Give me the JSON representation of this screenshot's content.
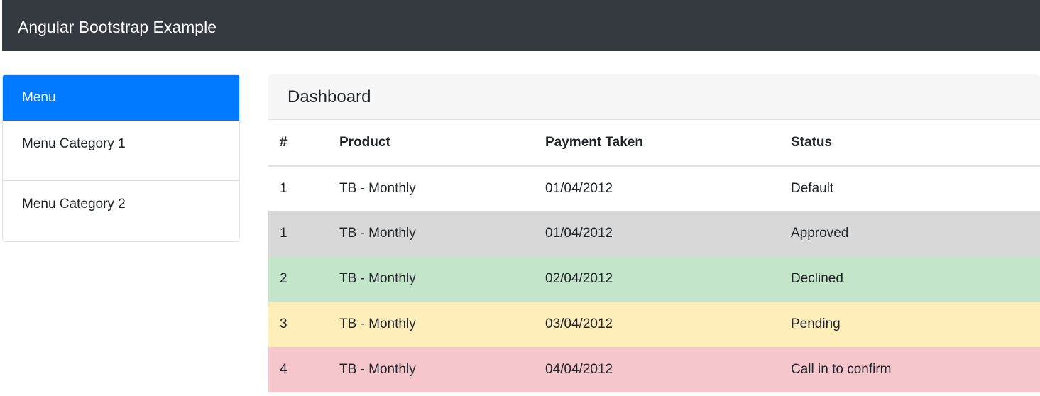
{
  "navbar": {
    "brand": "Angular Bootstrap Example"
  },
  "sidebar": {
    "header": "Menu",
    "items": [
      {
        "label": "Menu Category 1"
      },
      {
        "label": "Menu Category 2"
      }
    ]
  },
  "dashboard": {
    "title": "Dashboard",
    "columns": [
      "#",
      "Product",
      "Payment Taken",
      "Status"
    ],
    "rows": [
      {
        "id": "1",
        "product": "TB - Monthly",
        "payment": "01/04/2012",
        "status": "Default",
        "bg": "#ffffff"
      },
      {
        "id": "1",
        "product": "TB - Monthly",
        "payment": "01/04/2012",
        "status": "Approved",
        "bg": "#d8d8d8"
      },
      {
        "id": "2",
        "product": "TB - Monthly",
        "payment": "02/04/2012",
        "status": "Declined",
        "bg": "#c3e6cb"
      },
      {
        "id": "3",
        "product": "TB - Monthly",
        "payment": "03/04/2012",
        "status": "Pending",
        "bg": "#ffeeba"
      },
      {
        "id": "4",
        "product": "TB - Monthly",
        "payment": "04/04/2012",
        "status": "Call in to confirm",
        "bg": "#f5c6cb"
      }
    ]
  },
  "colors": {
    "navbar": "#343a40",
    "accent": "#007bff",
    "panel_header": "#f7f7f7",
    "border": "#dfe2e5"
  }
}
